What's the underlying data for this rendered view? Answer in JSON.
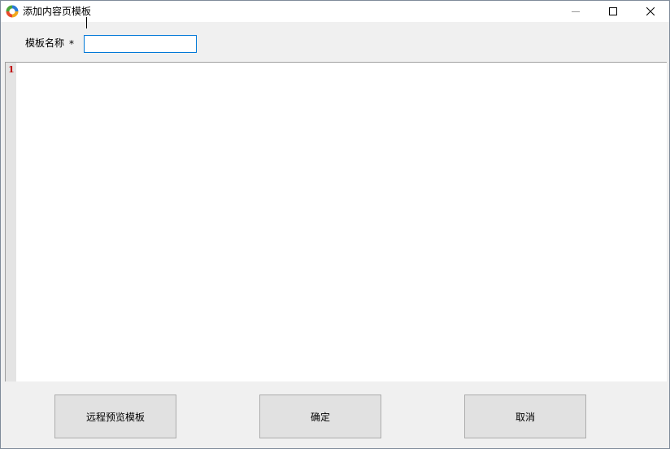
{
  "window": {
    "title": "添加内容页模板",
    "controls": {
      "minimize_icon": "minimize-icon",
      "maximize_icon": "maximize-icon",
      "close_icon": "close-icon"
    }
  },
  "form": {
    "name_label": "模板名称",
    "required_marker": "*",
    "name_value": ""
  },
  "editor": {
    "line_numbers": [
      "1"
    ],
    "content": ""
  },
  "buttons": {
    "preview_label": "远程预览模板",
    "ok_label": "确定",
    "cancel_label": "取消"
  },
  "colors": {
    "input_focus_border": "#0078d7",
    "line_number": "#c00000",
    "gutter": "#e4e4e4",
    "button_face": "#e1e1e1"
  }
}
